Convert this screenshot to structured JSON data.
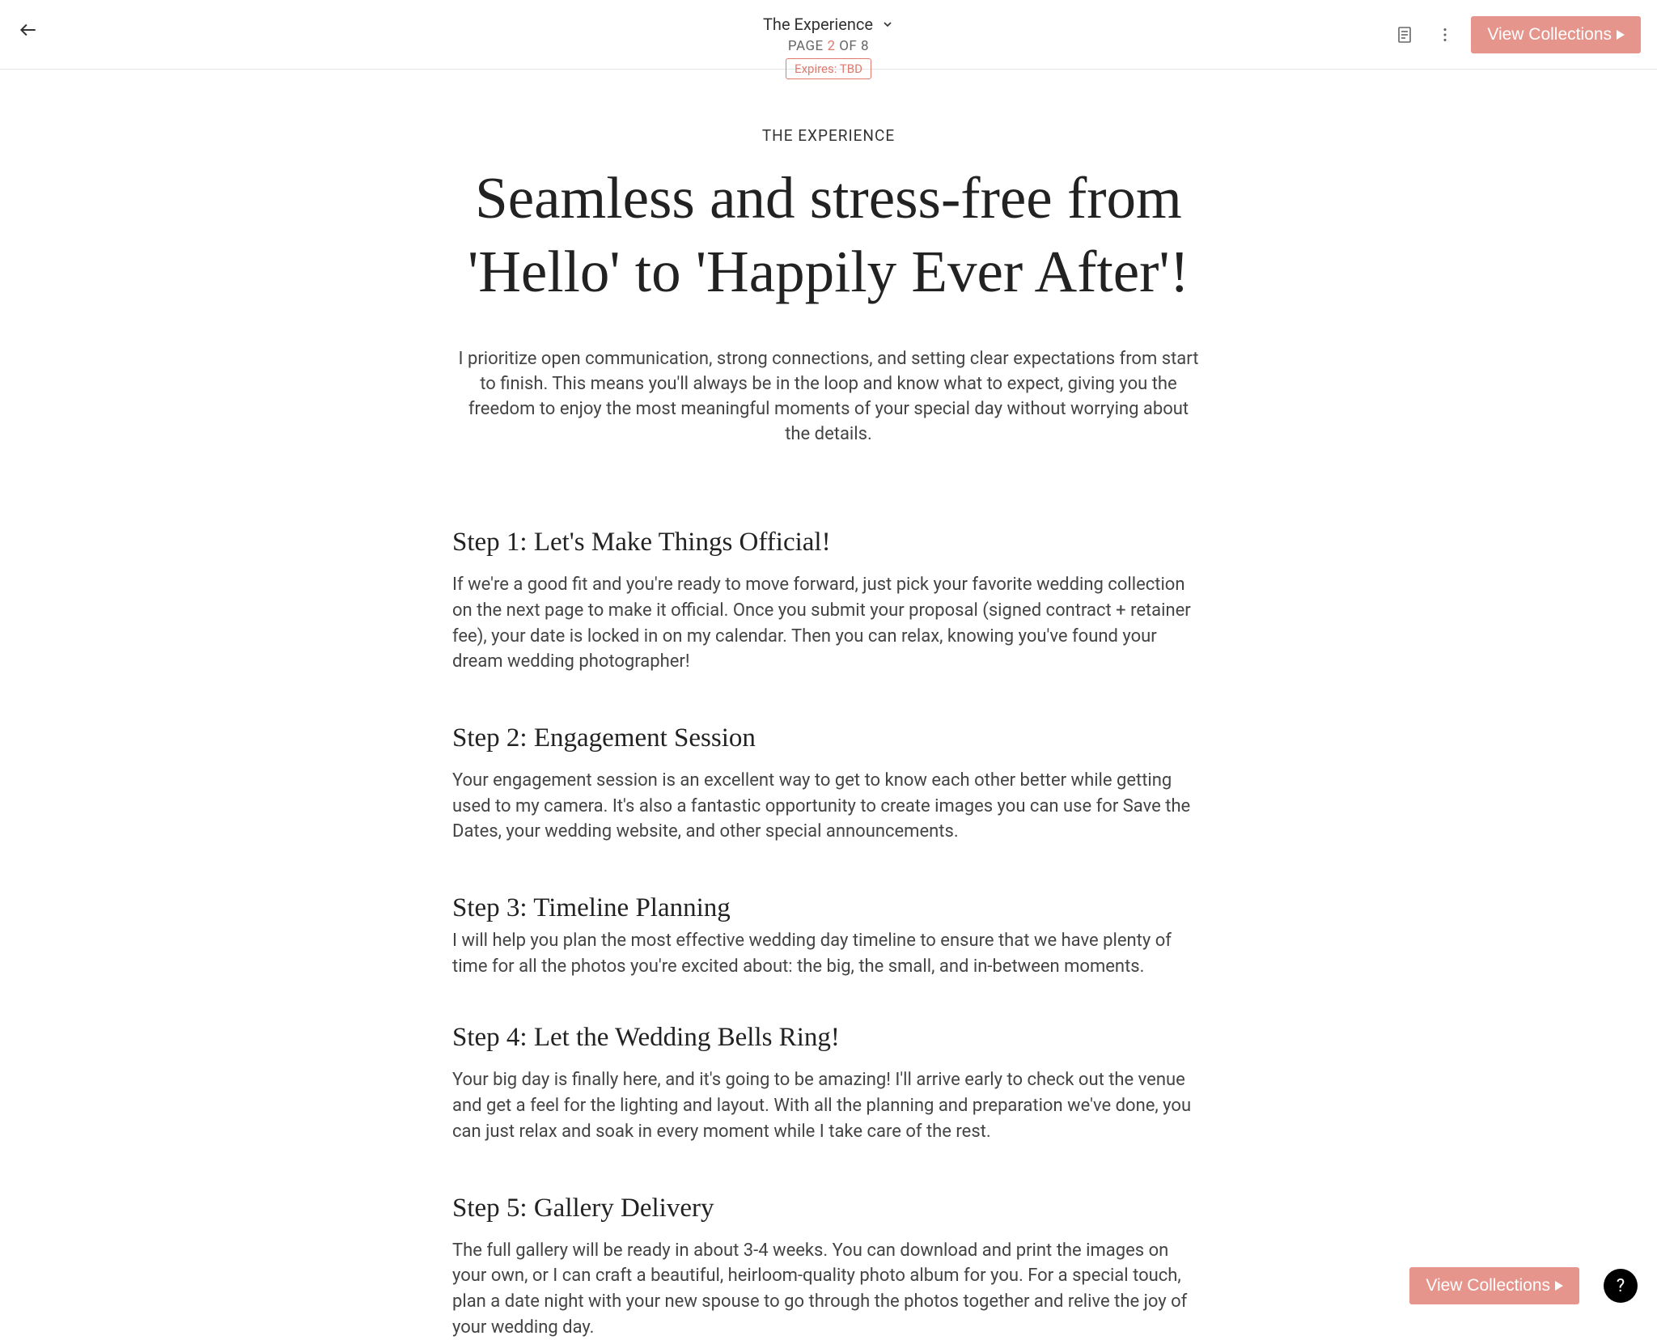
{
  "header": {
    "dropdown_title": "The Experience",
    "page_label_prefix": "PAGE ",
    "page_current": "2",
    "page_label_mid": " OF ",
    "page_total": "8",
    "expires_label": "Expires: TBD",
    "view_collections": "View Collections"
  },
  "content": {
    "eyebrow": "THE EXPERIENCE",
    "title": "Seamless and stress-free from 'Hello' to 'Happily Ever After'!",
    "intro": "I prioritize open communication, strong connections, and setting clear expectations from start to finish. This means you'll always be in the loop and know what to expect, giving you the freedom to enjoy the most meaningful moments of your special day without worrying about the details.",
    "steps": [
      {
        "title": "Step 1: Let's Make Things Official!",
        "body": "If we're a good fit and you're ready to move forward, just pick your favorite wedding collection on the next page to make it official. Once you submit your proposal (signed contract + retainer fee), your date is locked in on my calendar. Then you can relax, knowing you've found your dream wedding photographer!"
      },
      {
        "title": "Step 2: Engagement Session",
        "body": "Your engagement session is an excellent way to get to know each other better while getting used to my camera. It's also a fantastic opportunity to create images you can use for Save the Dates, your wedding website, and other special announcements."
      },
      {
        "title": "Step 3: Timeline Planning",
        "body": "I will help you plan the most effective wedding day timeline to ensure that we have plenty of time for all the photos you're excited about: the big, the small, and in-between moments."
      },
      {
        "title": "Step 4: Let the Wedding Bells Ring!",
        "body": "Your big day is finally here, and it's going to be amazing! I'll arrive early to check out the venue and get a feel for the lighting and layout. With all the planning and preparation we've done, you can just relax and soak in every moment while I take care of the rest."
      },
      {
        "title": "Step 5: Gallery Delivery",
        "body": "The full gallery will be ready in about 3-4 weeks. You can download and print the images on your own, or I can craft a beautiful, heirloom-quality photo album for you. For a special touch, plan a date night with your new spouse to go through the photos together and relive the joy of your wedding day."
      }
    ]
  },
  "footer": {
    "view_collections": "View Collections",
    "help": "?"
  }
}
